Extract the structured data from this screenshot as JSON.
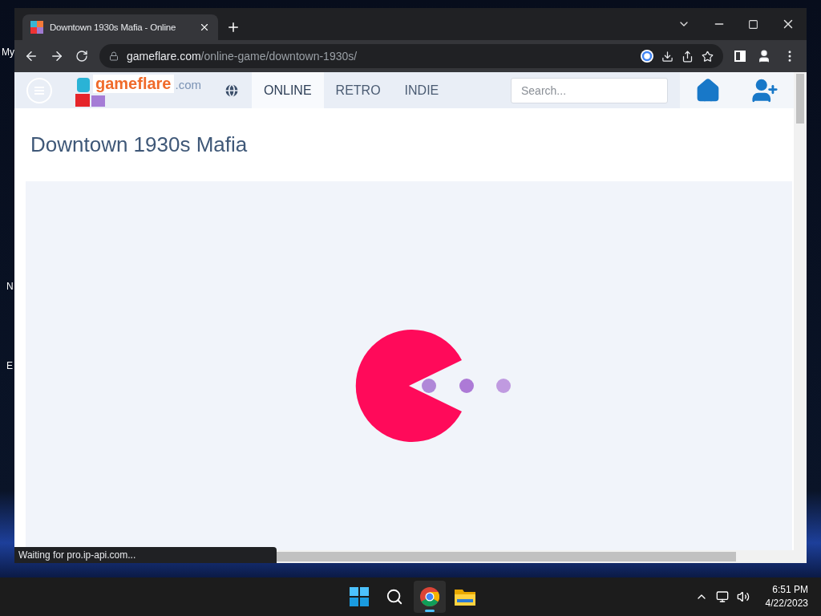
{
  "desktop": {
    "icon_labels": [
      "My",
      "N",
      "E"
    ]
  },
  "browser": {
    "tab": {
      "title": "Downtown 1930s Mafia - Online",
      "selected": true
    },
    "url": {
      "host": "gameflare.com",
      "path": "/online-game/downtown-1930s/"
    },
    "status": "Waiting for pro.ip-api.com..."
  },
  "site": {
    "logo": {
      "name": "gameflare",
      "suffix": ".com"
    },
    "nav": [
      {
        "label": "ONLINE",
        "selected": true
      },
      {
        "label": "RETRO",
        "selected": false
      },
      {
        "label": "INDIE",
        "selected": false
      }
    ],
    "search": {
      "placeholder": "Search..."
    },
    "title": "Downtown 1930s Mafia"
  },
  "taskbar": {
    "apps": [
      {
        "kind": "start",
        "selected": false
      },
      {
        "kind": "search",
        "selected": false
      },
      {
        "kind": "chrome",
        "selected": true
      },
      {
        "kind": "files",
        "selected": false
      }
    ],
    "time": "6:51 PM",
    "date": "4/22/2023"
  }
}
